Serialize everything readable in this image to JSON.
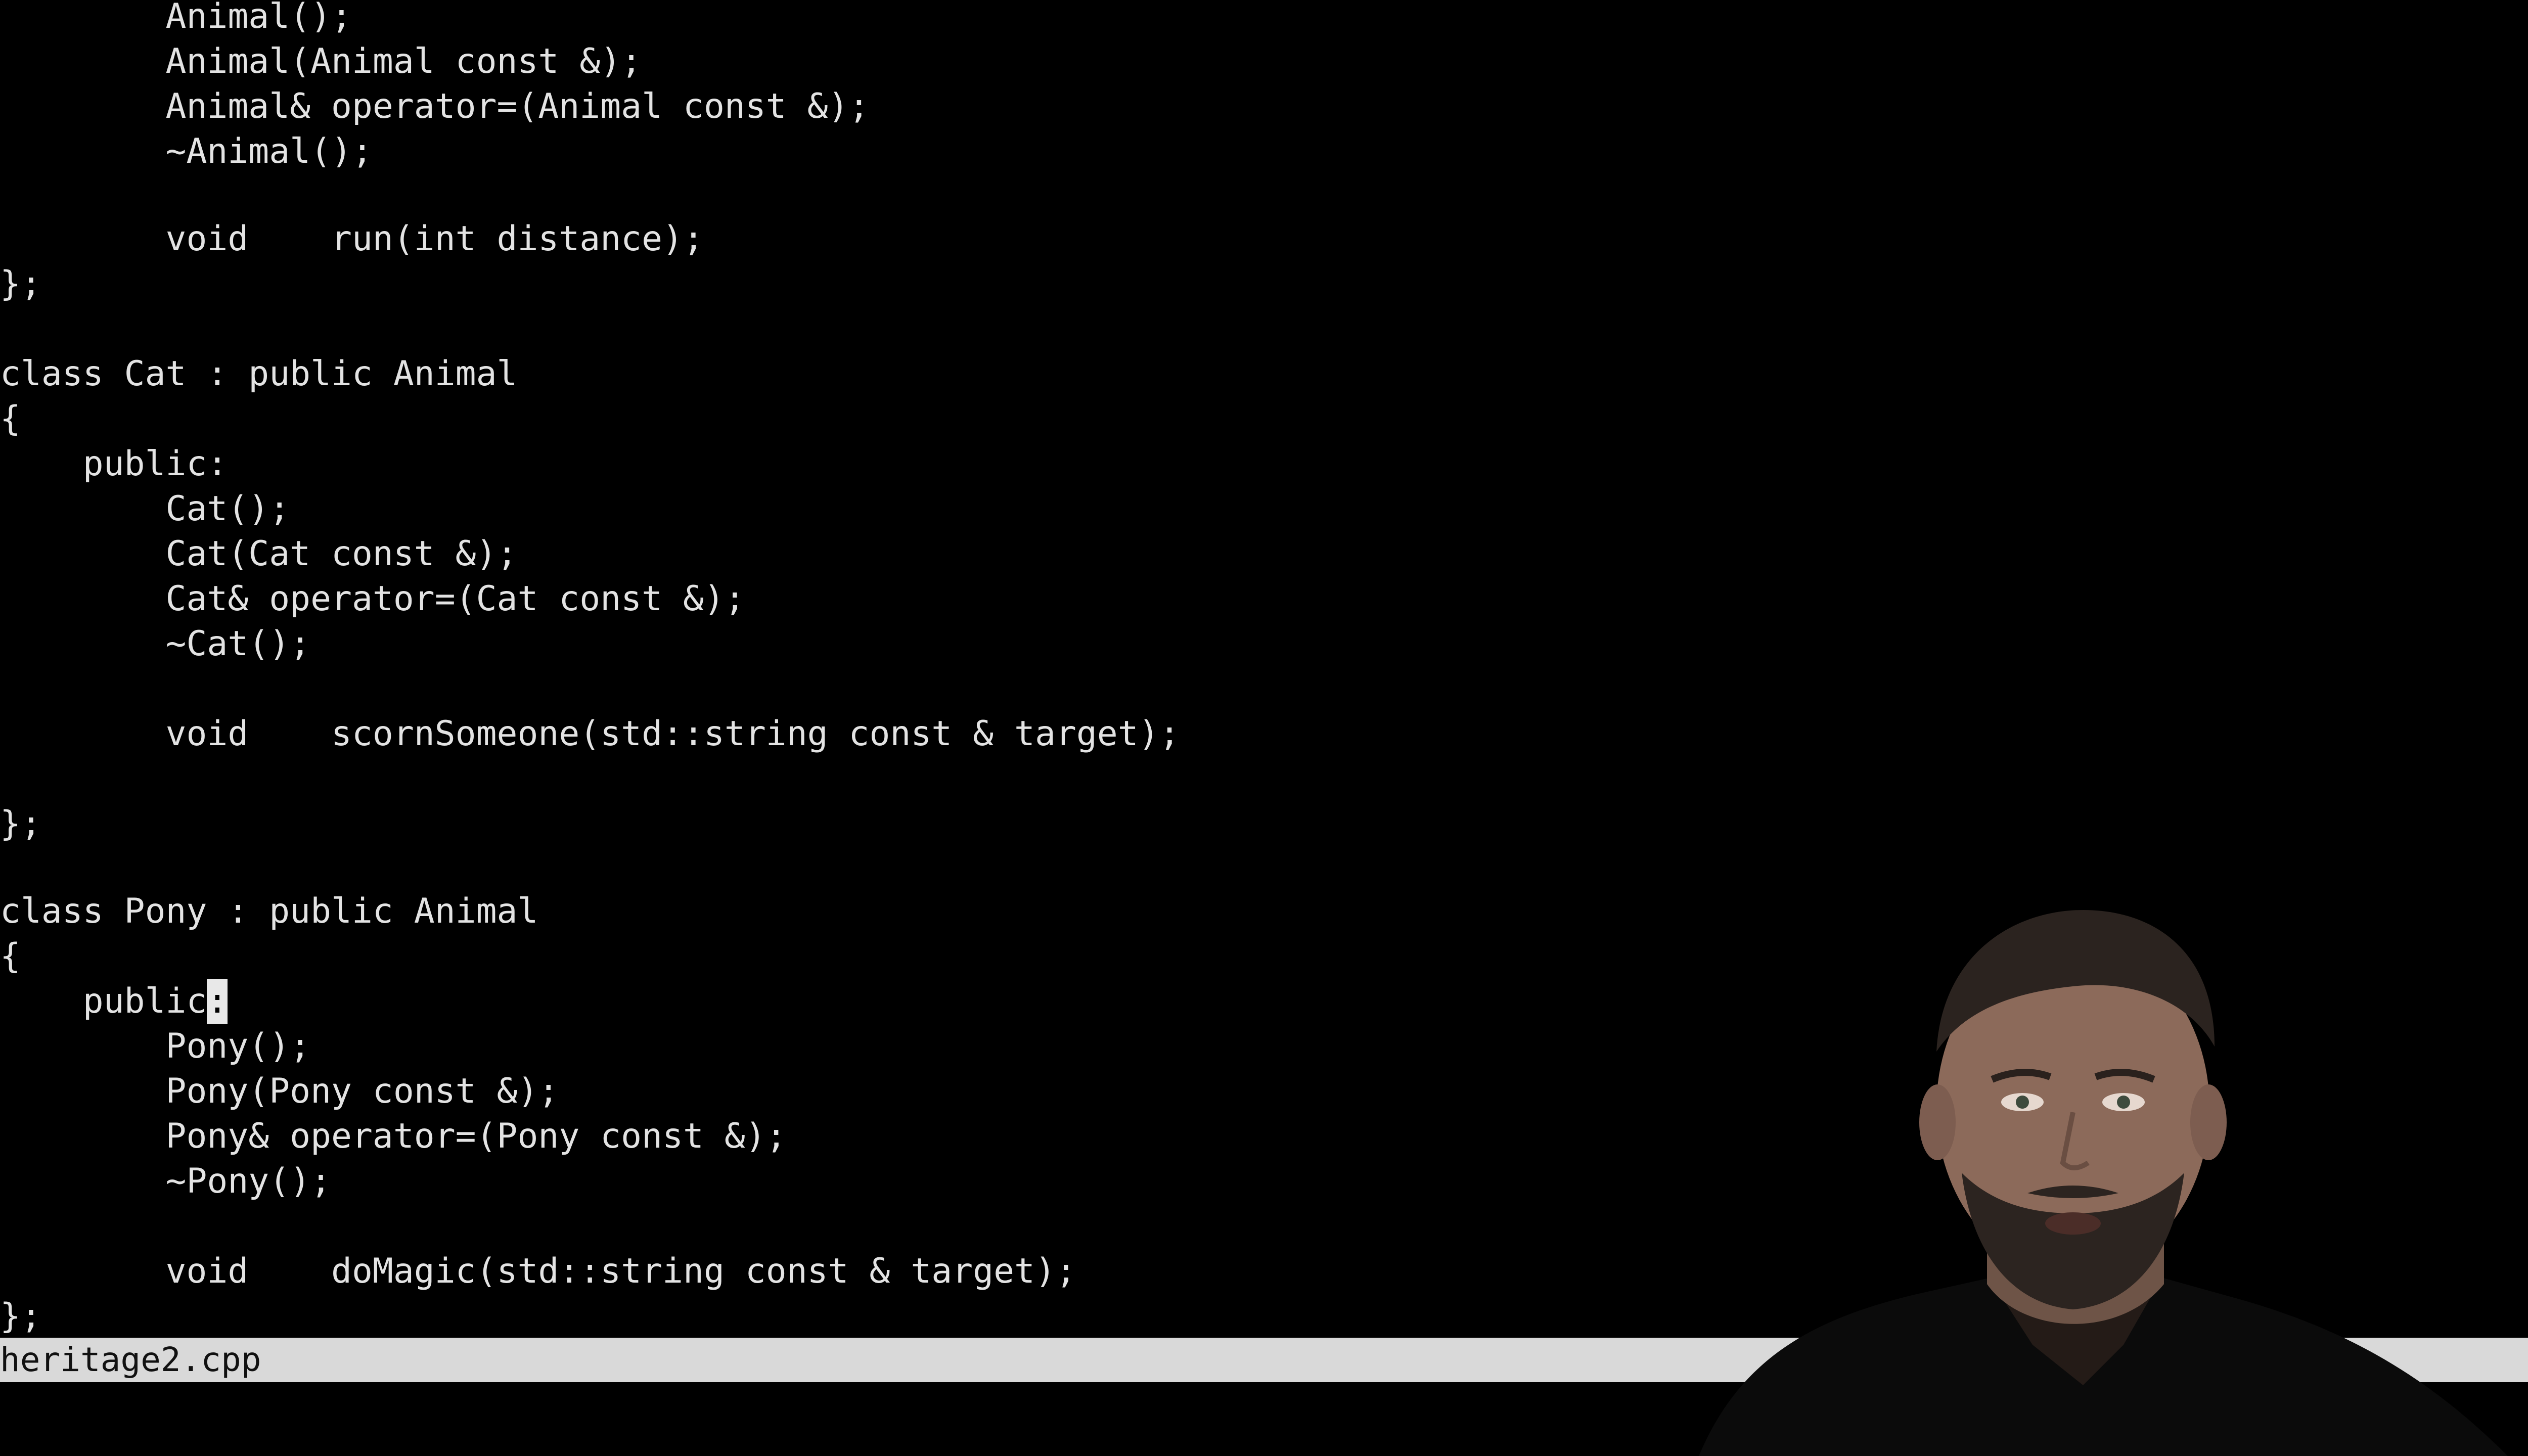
{
  "editor": {
    "lines": [
      "        Animal();",
      "        Animal(Animal const &);",
      "        Animal& operator=(Animal const &);",
      "        ~Animal();",
      "",
      "        void    run(int distance);",
      "};",
      "",
      "class Cat : public Animal",
      "{",
      "    public:",
      "        Cat();",
      "        Cat(Cat const &);",
      "        Cat& operator=(Cat const &);",
      "        ~Cat();",
      "",
      "        void    scornSomeone(std::string const & target);",
      "",
      "};",
      "",
      "class Pony : public Animal",
      "{",
      "        Pony();",
      "        Pony(Pony const &);",
      "        Pony& operator=(Pony const &);",
      "        ~Pony();",
      "",
      "        void    doMagic(std::string const & target);",
      "};"
    ],
    "cursor_line": {
      "before": "    public",
      "cursor_char": ":"
    }
  },
  "status_bar": {
    "filename": "heritage2.cpp"
  },
  "colors": {
    "background": "#000000",
    "text": "#e3e3e3",
    "status_bar": "#d9d9d9"
  }
}
